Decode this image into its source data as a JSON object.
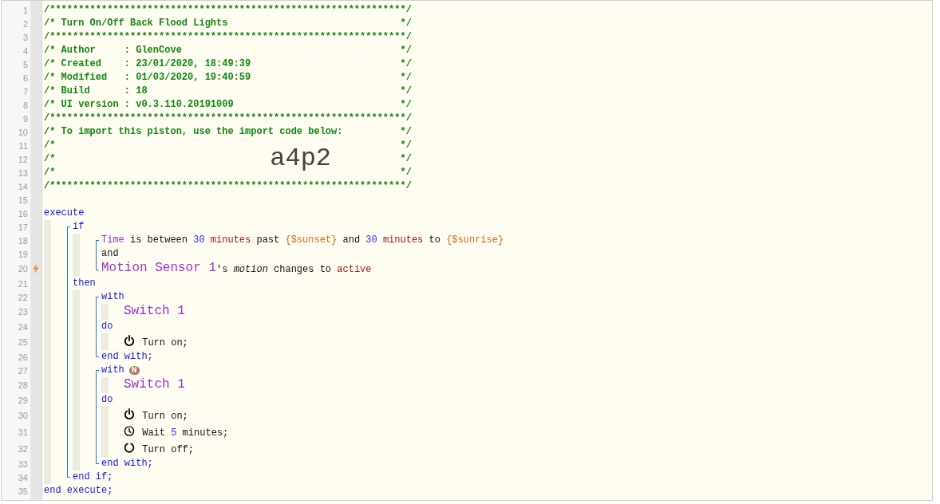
{
  "header": [
    {
      "number": "1",
      "text": "/**************************************************************/"
    },
    {
      "number": "2",
      "text": "/* Turn On/Off Back Flood Lights",
      "end": "*/"
    },
    {
      "number": "3",
      "text": "/**************************************************************/"
    },
    {
      "number": "4",
      "text": "/* Author     : GlenCove",
      "end": "*/"
    },
    {
      "number": "5",
      "text": "/* Created    : 23/01/2020, 18:49:39",
      "end": "*/"
    },
    {
      "number": "6",
      "text": "/* Modified   : 01/03/2020, 19:40:59",
      "end": "*/"
    },
    {
      "number": "7",
      "text": "/* Build      : 18",
      "end": "*/"
    },
    {
      "number": "8",
      "text": "/* UI version : v0.3.110.20191009",
      "end": "*/"
    },
    {
      "number": "9",
      "text": "/**************************************************************/"
    },
    {
      "number": "10",
      "text": "/* To import this piston, use the import code below:",
      "end": "*/"
    },
    {
      "number": "11",
      "text": "/*",
      "end": "*/"
    },
    {
      "number": "12",
      "text": "/*",
      "code": "a4p2",
      "end": "*/"
    },
    {
      "number": "13",
      "text": "/*",
      "end": "*/"
    },
    {
      "number": "14",
      "text": "/**************************************************************/"
    },
    {
      "number": "15"
    }
  ],
  "script": [
    {
      "kind": "line",
      "number": "16",
      "tokens": [
        {
          "kind": "keyword",
          "text": "execute"
        }
      ]
    },
    {
      "kind": "indent",
      "children": [
        {
          "kind": "bracket",
          "children": [
            {
              "kind": "line",
              "number": "17",
              "tokens": [
                {
                  "kind": "keyword",
                  "text": "if"
                }
              ]
            },
            {
              "kind": "indent",
              "children": [
                {
                  "kind": "bracket",
                  "children": [
                    {
                      "kind": "line",
                      "number": "18",
                      "tokens": [
                        {
                          "kind": "subject",
                          "text": "Time"
                        },
                        {
                          "kind": "text",
                          "text": " is between "
                        },
                        {
                          "kind": "number",
                          "text": "30"
                        },
                        {
                          "kind": "unit",
                          "text": " minutes"
                        },
                        {
                          "kind": "text",
                          "text": " past "
                        },
                        {
                          "kind": "variable",
                          "text": "{$sunset}"
                        },
                        {
                          "kind": "text",
                          "text": " and "
                        },
                        {
                          "kind": "number",
                          "text": "30"
                        },
                        {
                          "kind": "unit",
                          "text": " minutes"
                        },
                        {
                          "kind": "text",
                          "text": " to "
                        },
                        {
                          "kind": "variable",
                          "text": "{$sunrise}"
                        }
                      ]
                    },
                    {
                      "kind": "line",
                      "number": "19",
                      "tokens": [
                        {
                          "kind": "text",
                          "text": "and"
                        }
                      ]
                    },
                    {
                      "kind": "line",
                      "number": "20",
                      "trigger": true,
                      "tokens": [
                        {
                          "kind": "device",
                          "text": "Motion Sensor 1"
                        },
                        {
                          "kind": "text",
                          "text": "'s "
                        },
                        {
                          "kind": "attribute",
                          "text": "motion"
                        },
                        {
                          "kind": "text",
                          "text": " changes to "
                        },
                        {
                          "kind": "value",
                          "text": "active"
                        }
                      ]
                    }
                  ]
                }
              ]
            },
            {
              "kind": "line",
              "number": "21",
              "tokens": [
                {
                  "kind": "keyword",
                  "text": "then"
                }
              ]
            },
            {
              "kind": "indent",
              "children": [
                {
                  "kind": "bracket",
                  "children": [
                    {
                      "kind": "line",
                      "number": "22",
                      "tokens": [
                        {
                          "kind": "keyword",
                          "text": "with"
                        }
                      ]
                    },
                    {
                      "kind": "indent",
                      "children": [
                        {
                          "kind": "line",
                          "number": "23",
                          "tokens": [
                            {
                              "kind": "device",
                              "text": "Switch 1"
                            }
                          ]
                        }
                      ]
                    },
                    {
                      "kind": "line",
                      "number": "24",
                      "tokens": [
                        {
                          "kind": "keyword",
                          "text": "do"
                        }
                      ]
                    },
                    {
                      "kind": "indent",
                      "children": [
                        {
                          "kind": "line",
                          "number": "25",
                          "tokens": [
                            {
                              "kind": "power_icon"
                            },
                            {
                              "kind": "text",
                              "text": " Turn on;"
                            }
                          ]
                        }
                      ]
                    },
                    {
                      "kind": "line",
                      "number": "26",
                      "tokens": [
                        {
                          "kind": "keyword",
                          "text": "end with;"
                        }
                      ]
                    }
                  ]
                },
                {
                  "kind": "bracket",
                  "children": [
                    {
                      "kind": "line",
                      "number": "27",
                      "tokens": [
                        {
                          "kind": "keyword",
                          "text": "with"
                        },
                        {
                          "kind": "badge",
                          "text": "N"
                        }
                      ]
                    },
                    {
                      "kind": "indent",
                      "children": [
                        {
                          "kind": "line",
                          "number": "28",
                          "tokens": [
                            {
                              "kind": "device",
                              "text": "Switch 1"
                            }
                          ]
                        }
                      ]
                    },
                    {
                      "kind": "line",
                      "number": "29",
                      "tokens": [
                        {
                          "kind": "keyword",
                          "text": "do"
                        }
                      ]
                    },
                    {
                      "kind": "indent",
                      "children": [
                        {
                          "kind": "line",
                          "number": "30",
                          "tokens": [
                            {
                              "kind": "power_icon"
                            },
                            {
                              "kind": "text",
                              "text": " Turn on;"
                            }
                          ]
                        },
                        {
                          "kind": "line",
                          "number": "31",
                          "tokens": [
                            {
                              "kind": "clock_icon"
                            },
                            {
                              "kind": "text",
                              "text": " Wait "
                            },
                            {
                              "kind": "number",
                              "text": "5"
                            },
                            {
                              "kind": "text",
                              "text": " minutes;"
                            }
                          ]
                        },
                        {
                          "kind": "line",
                          "number": "32",
                          "tokens": [
                            {
                              "kind": "ring_icon"
                            },
                            {
                              "kind": "text",
                              "text": " Turn off;"
                            }
                          ]
                        }
                      ]
                    },
                    {
                      "kind": "line",
                      "number": "33",
                      "tokens": [
                        {
                          "kind": "keyword",
                          "text": "end with;"
                        }
                      ]
                    }
                  ]
                }
              ]
            },
            {
              "kind": "line",
              "number": "34",
              "tokens": [
                {
                  "kind": "keyword",
                  "text": "end if;"
                }
              ]
            }
          ]
        }
      ]
    },
    {
      "kind": "line",
      "number": "35",
      "tokens": [
        {
          "kind": "keyword",
          "text": "end execute;"
        }
      ]
    }
  ]
}
